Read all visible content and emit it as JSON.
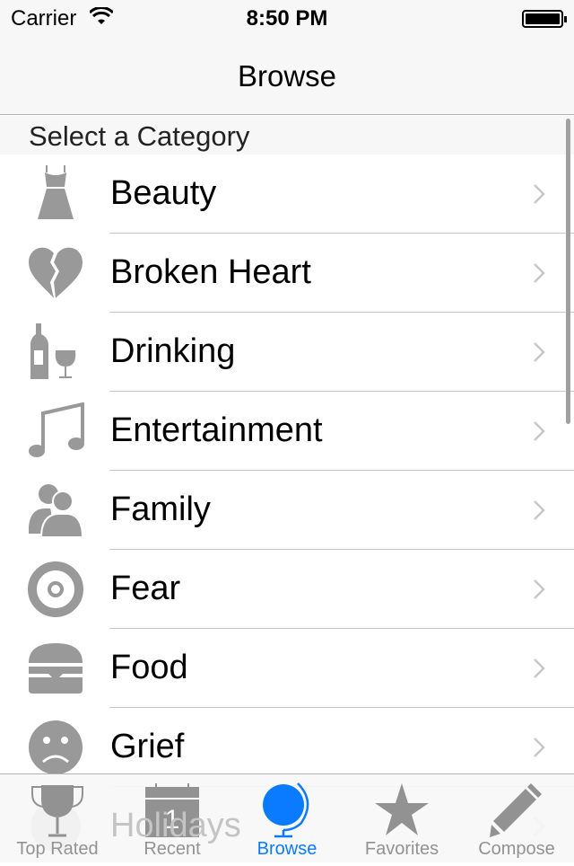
{
  "status": {
    "carrier": "Carrier",
    "time": "8:50 PM"
  },
  "nav": {
    "title": "Browse"
  },
  "section_header": "Select a Category",
  "categories": [
    {
      "label": "Beauty",
      "icon": "dress-icon"
    },
    {
      "label": "Broken Heart",
      "icon": "broken-heart-icon"
    },
    {
      "label": "Drinking",
      "icon": "wine-icon"
    },
    {
      "label": "Entertainment",
      "icon": "music-note-icon"
    },
    {
      "label": "Family",
      "icon": "people-icon"
    },
    {
      "label": "Fear",
      "icon": "target-icon"
    },
    {
      "label": "Food",
      "icon": "burger-icon"
    },
    {
      "label": "Grief",
      "icon": "sad-face-icon"
    },
    {
      "label": "Holidays",
      "icon": "holiday-icon"
    }
  ],
  "tabs": [
    {
      "label": "Top Rated",
      "icon": "trophy-icon"
    },
    {
      "label": "Recent",
      "icon": "calendar-icon",
      "day": "1"
    },
    {
      "label": "Browse",
      "icon": "globe-icon",
      "active": true
    },
    {
      "label": "Favorites",
      "icon": "star-icon"
    },
    {
      "label": "Compose",
      "icon": "pencil-icon"
    }
  ],
  "colors": {
    "accent": "#0a7afe",
    "icon_gray": "#999999"
  }
}
